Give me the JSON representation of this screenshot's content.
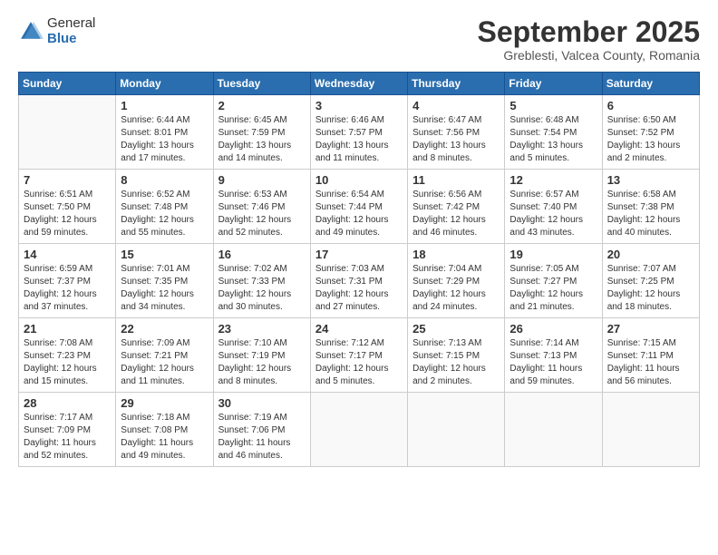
{
  "header": {
    "logo_general": "General",
    "logo_blue": "Blue",
    "month_title": "September 2025",
    "location": "Greblesti, Valcea County, Romania"
  },
  "weekdays": [
    "Sunday",
    "Monday",
    "Tuesday",
    "Wednesday",
    "Thursday",
    "Friday",
    "Saturday"
  ],
  "days": [
    {
      "date": "",
      "info": ""
    },
    {
      "date": "1",
      "info": "Sunrise: 6:44 AM\nSunset: 8:01 PM\nDaylight: 13 hours\nand 17 minutes."
    },
    {
      "date": "2",
      "info": "Sunrise: 6:45 AM\nSunset: 7:59 PM\nDaylight: 13 hours\nand 14 minutes."
    },
    {
      "date": "3",
      "info": "Sunrise: 6:46 AM\nSunset: 7:57 PM\nDaylight: 13 hours\nand 11 minutes."
    },
    {
      "date": "4",
      "info": "Sunrise: 6:47 AM\nSunset: 7:56 PM\nDaylight: 13 hours\nand 8 minutes."
    },
    {
      "date": "5",
      "info": "Sunrise: 6:48 AM\nSunset: 7:54 PM\nDaylight: 13 hours\nand 5 minutes."
    },
    {
      "date": "6",
      "info": "Sunrise: 6:50 AM\nSunset: 7:52 PM\nDaylight: 13 hours\nand 2 minutes."
    },
    {
      "date": "7",
      "info": "Sunrise: 6:51 AM\nSunset: 7:50 PM\nDaylight: 12 hours\nand 59 minutes."
    },
    {
      "date": "8",
      "info": "Sunrise: 6:52 AM\nSunset: 7:48 PM\nDaylight: 12 hours\nand 55 minutes."
    },
    {
      "date": "9",
      "info": "Sunrise: 6:53 AM\nSunset: 7:46 PM\nDaylight: 12 hours\nand 52 minutes."
    },
    {
      "date": "10",
      "info": "Sunrise: 6:54 AM\nSunset: 7:44 PM\nDaylight: 12 hours\nand 49 minutes."
    },
    {
      "date": "11",
      "info": "Sunrise: 6:56 AM\nSunset: 7:42 PM\nDaylight: 12 hours\nand 46 minutes."
    },
    {
      "date": "12",
      "info": "Sunrise: 6:57 AM\nSunset: 7:40 PM\nDaylight: 12 hours\nand 43 minutes."
    },
    {
      "date": "13",
      "info": "Sunrise: 6:58 AM\nSunset: 7:38 PM\nDaylight: 12 hours\nand 40 minutes."
    },
    {
      "date": "14",
      "info": "Sunrise: 6:59 AM\nSunset: 7:37 PM\nDaylight: 12 hours\nand 37 minutes."
    },
    {
      "date": "15",
      "info": "Sunrise: 7:01 AM\nSunset: 7:35 PM\nDaylight: 12 hours\nand 34 minutes."
    },
    {
      "date": "16",
      "info": "Sunrise: 7:02 AM\nSunset: 7:33 PM\nDaylight: 12 hours\nand 30 minutes."
    },
    {
      "date": "17",
      "info": "Sunrise: 7:03 AM\nSunset: 7:31 PM\nDaylight: 12 hours\nand 27 minutes."
    },
    {
      "date": "18",
      "info": "Sunrise: 7:04 AM\nSunset: 7:29 PM\nDaylight: 12 hours\nand 24 minutes."
    },
    {
      "date": "19",
      "info": "Sunrise: 7:05 AM\nSunset: 7:27 PM\nDaylight: 12 hours\nand 21 minutes."
    },
    {
      "date": "20",
      "info": "Sunrise: 7:07 AM\nSunset: 7:25 PM\nDaylight: 12 hours\nand 18 minutes."
    },
    {
      "date": "21",
      "info": "Sunrise: 7:08 AM\nSunset: 7:23 PM\nDaylight: 12 hours\nand 15 minutes."
    },
    {
      "date": "22",
      "info": "Sunrise: 7:09 AM\nSunset: 7:21 PM\nDaylight: 12 hours\nand 11 minutes."
    },
    {
      "date": "23",
      "info": "Sunrise: 7:10 AM\nSunset: 7:19 PM\nDaylight: 12 hours\nand 8 minutes."
    },
    {
      "date": "24",
      "info": "Sunrise: 7:12 AM\nSunset: 7:17 PM\nDaylight: 12 hours\nand 5 minutes."
    },
    {
      "date": "25",
      "info": "Sunrise: 7:13 AM\nSunset: 7:15 PM\nDaylight: 12 hours\nand 2 minutes."
    },
    {
      "date": "26",
      "info": "Sunrise: 7:14 AM\nSunset: 7:13 PM\nDaylight: 11 hours\nand 59 minutes."
    },
    {
      "date": "27",
      "info": "Sunrise: 7:15 AM\nSunset: 7:11 PM\nDaylight: 11 hours\nand 56 minutes."
    },
    {
      "date": "28",
      "info": "Sunrise: 7:17 AM\nSunset: 7:09 PM\nDaylight: 11 hours\nand 52 minutes."
    },
    {
      "date": "29",
      "info": "Sunrise: 7:18 AM\nSunset: 7:08 PM\nDaylight: 11 hours\nand 49 minutes."
    },
    {
      "date": "30",
      "info": "Sunrise: 7:19 AM\nSunset: 7:06 PM\nDaylight: 11 hours\nand 46 minutes."
    },
    {
      "date": "",
      "info": ""
    },
    {
      "date": "",
      "info": ""
    },
    {
      "date": "",
      "info": ""
    },
    {
      "date": "",
      "info": ""
    }
  ]
}
